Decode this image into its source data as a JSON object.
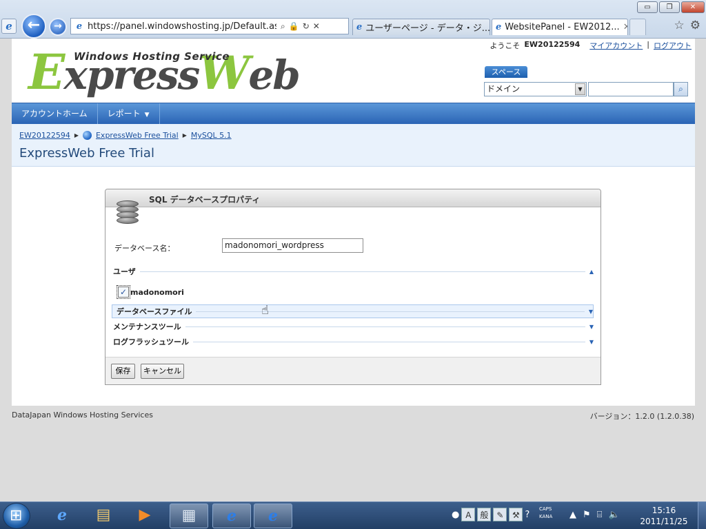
{
  "window": {
    "minimize_glyph": "▭",
    "restore_glyph": "❐",
    "close_glyph": "✕"
  },
  "browser": {
    "url": "https://panel.windowshosting.jp/Default.aspx?p",
    "tabs": [
      {
        "label": "ユーザーページ - データ・ジ..."
      },
      {
        "label": "WebsitePanel - EW2012..."
      }
    ],
    "icons": [
      "ie-icon",
      "back-arrow-icon",
      "forward-arrow-icon",
      "search-icon",
      "lock-icon",
      "refresh-icon",
      "stop-icon",
      "favorites-star-icon",
      "gear-icon"
    ]
  },
  "header": {
    "logo_small": "Windows Hosting Service",
    "logo_big_1": "E",
    "logo_big_2": "xpress",
    "logo_big_3": "W",
    "logo_big_4": "eb",
    "welcome_prefix": "ようこそ",
    "username": "EW20122594",
    "my_account": "マイアカウント",
    "separator": "|",
    "logout": "ログアウト",
    "space_label": "スペース",
    "search_select_value": "ドメイン",
    "search_placeholder": ""
  },
  "nav": {
    "items": [
      {
        "label": "アカウントホーム"
      },
      {
        "label": "レポート"
      }
    ]
  },
  "breadcrumb": {
    "items": [
      "EW20122594",
      "ExpressWeb Free Trial",
      "MySQL 5.1"
    ]
  },
  "page": {
    "title": "ExpressWeb Free Trial"
  },
  "panel": {
    "title": "SQL データベースプロパティ",
    "db_name_label": "データベース名：",
    "db_name_value": "madonomori_wordpress",
    "sections": {
      "users": "ユーザ",
      "files": "データベースファイル",
      "maintenance": "メンテナンスツール",
      "log_flush": "ログフラッシュツール"
    },
    "user_checked": true,
    "user_name": "madonomori",
    "save_label": "保存",
    "cancel_label": "キャンセル"
  },
  "footer": {
    "left": "DataJapan Windows Hosting Services",
    "right": "バージョン：1.2.0 (1.2.0.38)"
  },
  "taskbar": {
    "ime_mode": "A",
    "ime_kanji": "般",
    "caps": "CAPS",
    "kana": "KANA",
    "time": "15:16",
    "date": "2011/11/25"
  }
}
